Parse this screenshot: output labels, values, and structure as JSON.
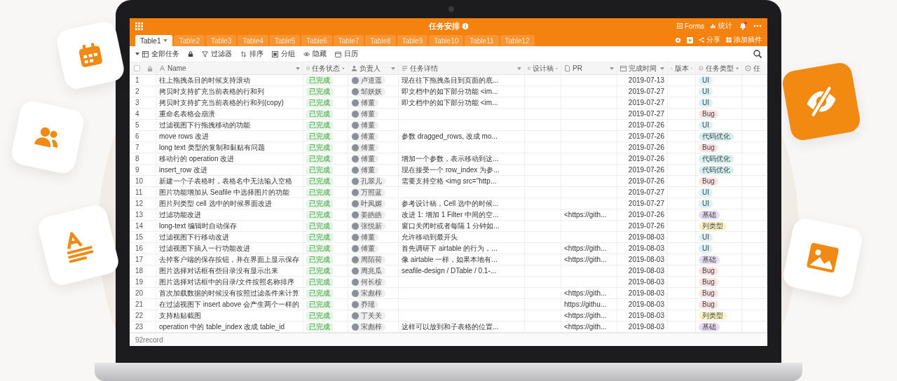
{
  "app": {
    "title": "任务安排",
    "actions": [
      {
        "kind": "forms",
        "label": "Forms"
      },
      {
        "kind": "stats",
        "label": "统计"
      }
    ]
  },
  "tabs": [
    {
      "label": "Table1",
      "selected": true
    },
    {
      "label": "Table2",
      "selected": false
    },
    {
      "label": "Table3",
      "selected": false
    },
    {
      "label": "Table4",
      "selected": false
    },
    {
      "label": "Table5",
      "selected": false
    },
    {
      "label": "Table6",
      "selected": false
    },
    {
      "label": "Table7",
      "selected": false
    },
    {
      "label": "Table8",
      "selected": false
    },
    {
      "label": "Table9",
      "selected": false
    },
    {
      "label": "Table10",
      "selected": false
    },
    {
      "label": "Table11",
      "selected": false
    },
    {
      "label": "Table12",
      "selected": false
    }
  ],
  "tab_actions": [
    {
      "kind": "share",
      "label": "分享"
    },
    {
      "kind": "plugin",
      "label": "添加插件"
    }
  ],
  "toolbar": {
    "view": "全部任务",
    "tools": [
      {
        "kind": "filter",
        "label": "过滤器"
      },
      {
        "kind": "sort",
        "label": "排序"
      },
      {
        "kind": "group",
        "label": "分组"
      },
      {
        "kind": "hide",
        "label": "隐藏"
      },
      {
        "kind": "calendar",
        "label": "日历"
      }
    ]
  },
  "select_all": {
    "checked": false
  },
  "columns": [
    {
      "kind": "text",
      "label": "Name"
    },
    {
      "kind": "select",
      "label": "任务状态"
    },
    {
      "kind": "person",
      "label": "负责人"
    },
    {
      "kind": "longtext",
      "label": "任务详情"
    },
    {
      "kind": "image",
      "label": "设计稿"
    },
    {
      "kind": "file",
      "label": "PR"
    },
    {
      "kind": "date",
      "label": "完成时间"
    },
    {
      "kind": "text",
      "label": "版本"
    },
    {
      "kind": "select",
      "label": "任务类型"
    },
    {
      "kind": "select",
      "label": "任"
    }
  ],
  "rows": [
    {
      "num": "1",
      "name": "往上拖拽条目的时候支持滚动",
      "status": "已完成",
      "assignee": "卢道遥",
      "detail": "现在往下拖拽条目到页面的底...",
      "date": "2019-07-13",
      "type": {
        "label": "UI",
        "color": "#d8f2f6"
      }
    },
    {
      "num": "2",
      "name": "拷贝时支持扩充当前表格的行和列",
      "status": "已完成",
      "assignee": "邹妖妖",
      "detail": "即文档中的如下部分功能 <im...",
      "date": "2019-07-27",
      "type": {
        "label": "UI",
        "color": "#d8f2f6"
      }
    },
    {
      "num": "3",
      "name": "拷贝时支持扩充当前表格的行和列(copy)",
      "status": "已完成",
      "assignee": "傅董",
      "detail": "即文档中的如下部分功能 <im...",
      "date": "2019-07-27",
      "type": {
        "label": "UI",
        "color": "#d8f2f6"
      }
    },
    {
      "num": "4",
      "name": "重命名表格会崩溃",
      "status": "已完成",
      "assignee": "傅董",
      "date": "2019-07-27",
      "type": {
        "label": "Bug",
        "color": "#fbe3e3"
      }
    },
    {
      "num": "5",
      "name": "过滤视图下行拖拽移动的功能",
      "status": "已完成",
      "assignee": "傅董",
      "date": "2019-07-26",
      "type": {
        "label": "UI",
        "color": "#d8f2f6"
      }
    },
    {
      "num": "6",
      "name": "move rows 改进",
      "status": "已完成",
      "assignee": "傅董",
      "detail": "参数 dragged_rows, 改成 mo...",
      "date": "2019-07-26",
      "type": {
        "label": "代码优化",
        "color": "#d5f1ef"
      }
    },
    {
      "num": "7",
      "name": "long text 类型的复制和黏贴有问题",
      "status": "已完成",
      "assignee": "傅董",
      "date": "2019-07-26",
      "type": {
        "label": "Bug",
        "color": "#fbe3e3"
      }
    },
    {
      "num": "8",
      "name": "移动行的 operation 改进",
      "status": "已完成",
      "assignee": "傅董",
      "detail": "增加一个参数，表示移动到这...",
      "date": "2019-07-26",
      "type": {
        "label": "代码优化",
        "color": "#d5f1ef"
      }
    },
    {
      "num": "9",
      "name": "insert_row 改进",
      "status": "已完成",
      "assignee": "傅董",
      "detail": "现在接受一个 row_index 为参...",
      "date": "2019-07-26",
      "type": {
        "label": "代码优化",
        "color": "#d5f1ef"
      }
    },
    {
      "num": "10",
      "name": "新建一个子表格时，表格名中无法输入空格",
      "status": "已完成",
      "assignee": "孔翠儿",
      "detail": "需要支持空格 <img src=\"http...",
      "date": "2019-07-26",
      "type": {
        "label": "Bug",
        "color": "#fbe3e3"
      }
    },
    {
      "num": "11",
      "name": "图片功能增加从 Seafile 中选择图片的功能",
      "status": "已完成",
      "assignee": "万照蓝",
      "date": "2019-07-27",
      "type": {
        "label": "UI",
        "color": "#d8f2f6"
      }
    },
    {
      "num": "12",
      "name": "图片列类型 cell 选中的时候界面改进",
      "status": "已完成",
      "assignee": "叶凤媚",
      "detail": "参考设计稿，Cell 选中的时候...",
      "date": "2019-07-27",
      "type": {
        "label": "UI",
        "color": "#d8f2f6"
      }
    },
    {
      "num": "13",
      "name": "过滤功能改进",
      "status": "已完成",
      "assignee": "姜皓皓",
      "detail": "改进 1: 增加 1 Filter 中间的空...",
      "pr": "<https://gith...",
      "date": "2019-07-26",
      "type": {
        "label": "基础",
        "color": "#e8dcf4"
      }
    },
    {
      "num": "14",
      "name": "long-text 编辑时自动保存",
      "status": "已完成",
      "assignee": "张悦新",
      "detail": "窗口关闭时或者每隔 1 分钟如...",
      "date": "2019-07-26",
      "type": {
        "label": "列类型",
        "color": "#fbf5c6"
      }
    },
    {
      "num": "15",
      "name": "过滤视图下行移动改进",
      "status": "已完成",
      "assignee": "傅董",
      "detail": "允许移动到最开头",
      "date": "2019-08-03",
      "type": {
        "label": "UI",
        "color": "#d8f2f6"
      }
    },
    {
      "num": "16",
      "name": "过滤视图下插入一行功能改进",
      "status": "已完成",
      "assignee": "傅董",
      "detail": "首先调研下 airtable 的行为，...",
      "pr": "<https://gith...",
      "date": "2019-08-03",
      "type": {
        "label": "UI",
        "color": "#d8f2f6"
      }
    },
    {
      "num": "17",
      "name": "去掉客户端的保存按钮，并在界面上显示保存",
      "status": "已完成",
      "assignee": "周陌荷",
      "detail": "像 airtable 一样，如果本地有...",
      "pr": "<https://gith...",
      "date": "2019-08-03",
      "type": {
        "label": "基础",
        "color": "#e8dcf4"
      }
    },
    {
      "num": "18",
      "name": "图片选择对话框有些目录没有显示出来",
      "status": "已完成",
      "assignee": "周兆瓜",
      "detail": "seafile-design / DTable / 0.1-...",
      "date": "2019-08-03",
      "type": {
        "label": "Bug",
        "color": "#fbe3e3"
      }
    },
    {
      "num": "19",
      "name": "图片选择对话框中的目录/文件按照名称排序",
      "status": "已完成",
      "assignee": "何长桉",
      "date": "2019-08-03",
      "type": {
        "label": "Bug",
        "color": "#fbe3e3"
      }
    },
    {
      "num": "20",
      "name": "首次加载数据的时候没有按照过滤条件来计算",
      "status": "已完成",
      "assignee": "宋彪梓",
      "pr": "<https://gith...",
      "date": "2019-08-03",
      "type": {
        "label": "Bug",
        "color": "#fbe3e3"
      }
    },
    {
      "num": "21",
      "name": "在过滤视图下 insert above 会产生两个一样的",
      "status": "已完成",
      "assignee": "乔瑶",
      "pr": "https://githu...",
      "date": "2019-08-03",
      "type": {
        "label": "Bug",
        "color": "#fbe3e3"
      }
    },
    {
      "num": "22",
      "name": "支持粘贴截图",
      "status": "已完成",
      "assignee": "丁关关",
      "pr": "<https://gith...",
      "date": "2019-08-03",
      "type": {
        "label": "列类型",
        "color": "#fbf5c6"
      }
    },
    {
      "num": "23",
      "name": "operation 中的 table_index 改成 table_id",
      "status": "已完成",
      "assignee": "宋彪梓",
      "detail": "这样可以放到和子表格的位置...",
      "pr": "<https://gith...",
      "date": "2019-08-03",
      "type": {
        "label": "基础",
        "color": "#e8dcf4"
      }
    }
  ],
  "footer": "92record"
}
